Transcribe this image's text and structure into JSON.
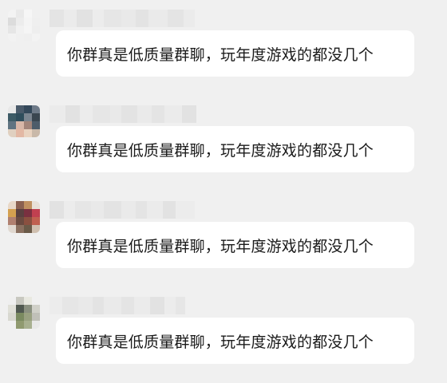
{
  "messages": [
    {
      "text": "你群真是低质量群聊，玩年度游戏的都没几个",
      "avatar_icon": "blurred-avatar-1",
      "avatar_colors": [
        "#f3f3f3",
        "#e9e9e9",
        "#f6f6f6",
        "#f0f0f0",
        "#dcdcdc",
        "#ececec",
        "#f4f4f4",
        "#efefef",
        "#e6e6e6",
        "#f1f1f1",
        "#f5f5f5",
        "#eeeeee",
        "#f2f2f2",
        "#f0f0f0",
        "#efefef",
        "#f3f3f3"
      ]
    },
    {
      "text": "你群真是低质量群聊，玩年度游戏的都没几个",
      "avatar_icon": "blurred-avatar-2",
      "avatar_colors": [
        "#e8e8e8",
        "#4a5a6a",
        "#34485a",
        "#6e7a88",
        "#3d5b66",
        "#2f4d5c",
        "#7b8590",
        "#3a4650",
        "#5f7381",
        "#d8b7a8",
        "#a3857a",
        "#4d5c6a",
        "#e0d0c0",
        "#e3b8a4",
        "#e9d3c0",
        "#c9b9a9"
      ]
    },
    {
      "text": "你群真是低质量群聊，玩年度游戏的都没几个",
      "avatar_icon": "blurred-avatar-3",
      "avatar_colors": [
        "#e8d8c8",
        "#8a6050",
        "#c09060",
        "#e8e0d8",
        "#d4a050",
        "#5a4040",
        "#7a3040",
        "#c04050",
        "#b08070",
        "#6a4a40",
        "#8a5040",
        "#c06050",
        "#e0d8d0",
        "#8a7060",
        "#6a5a48",
        "#d0c0b0"
      ]
    },
    {
      "text": "你群真是低质量群聊，玩年度游戏的都没几个",
      "avatar_icon": "blurred-avatar-4",
      "avatar_colors": [
        "#efefef",
        "#c8c8c0",
        "#e8e8e0",
        "#f0f0f0",
        "#e0e0d8",
        "#505850",
        "#8a9080",
        "#d0d0c8",
        "#d8d8d0",
        "#7a8a60",
        "#98a080",
        "#c0c0b8",
        "#f0f0f0",
        "#909a70",
        "#a8b090",
        "#e8e8e8"
      ]
    }
  ],
  "name_blur_colors": [
    "#e4e4e4",
    "#ebebeb",
    "#e2e2e2",
    "#ececec",
    "#e6e6e6",
    "#e9e9e9",
    "#e3e3e3",
    "#eaeaea"
  ]
}
